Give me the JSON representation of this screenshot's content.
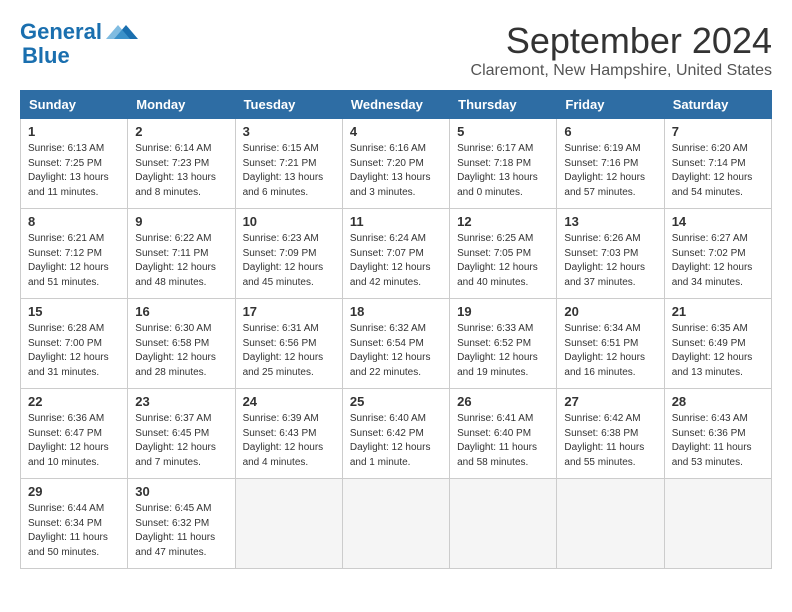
{
  "logo": {
    "line1": "General",
    "line2": "Blue"
  },
  "title": "September 2024",
  "location": "Claremont, New Hampshire, United States",
  "days_of_week": [
    "Sunday",
    "Monday",
    "Tuesday",
    "Wednesday",
    "Thursday",
    "Friday",
    "Saturday"
  ],
  "weeks": [
    [
      {
        "num": "1",
        "sunrise": "6:13 AM",
        "sunset": "7:25 PM",
        "daylight": "13 hours and 11 minutes."
      },
      {
        "num": "2",
        "sunrise": "6:14 AM",
        "sunset": "7:23 PM",
        "daylight": "13 hours and 8 minutes."
      },
      {
        "num": "3",
        "sunrise": "6:15 AM",
        "sunset": "7:21 PM",
        "daylight": "13 hours and 6 minutes."
      },
      {
        "num": "4",
        "sunrise": "6:16 AM",
        "sunset": "7:20 PM",
        "daylight": "13 hours and 3 minutes."
      },
      {
        "num": "5",
        "sunrise": "6:17 AM",
        "sunset": "7:18 PM",
        "daylight": "13 hours and 0 minutes."
      },
      {
        "num": "6",
        "sunrise": "6:19 AM",
        "sunset": "7:16 PM",
        "daylight": "12 hours and 57 minutes."
      },
      {
        "num": "7",
        "sunrise": "6:20 AM",
        "sunset": "7:14 PM",
        "daylight": "12 hours and 54 minutes."
      }
    ],
    [
      {
        "num": "8",
        "sunrise": "6:21 AM",
        "sunset": "7:12 PM",
        "daylight": "12 hours and 51 minutes."
      },
      {
        "num": "9",
        "sunrise": "6:22 AM",
        "sunset": "7:11 PM",
        "daylight": "12 hours and 48 minutes."
      },
      {
        "num": "10",
        "sunrise": "6:23 AM",
        "sunset": "7:09 PM",
        "daylight": "12 hours and 45 minutes."
      },
      {
        "num": "11",
        "sunrise": "6:24 AM",
        "sunset": "7:07 PM",
        "daylight": "12 hours and 42 minutes."
      },
      {
        "num": "12",
        "sunrise": "6:25 AM",
        "sunset": "7:05 PM",
        "daylight": "12 hours and 40 minutes."
      },
      {
        "num": "13",
        "sunrise": "6:26 AM",
        "sunset": "7:03 PM",
        "daylight": "12 hours and 37 minutes."
      },
      {
        "num": "14",
        "sunrise": "6:27 AM",
        "sunset": "7:02 PM",
        "daylight": "12 hours and 34 minutes."
      }
    ],
    [
      {
        "num": "15",
        "sunrise": "6:28 AM",
        "sunset": "7:00 PM",
        "daylight": "12 hours and 31 minutes."
      },
      {
        "num": "16",
        "sunrise": "6:30 AM",
        "sunset": "6:58 PM",
        "daylight": "12 hours and 28 minutes."
      },
      {
        "num": "17",
        "sunrise": "6:31 AM",
        "sunset": "6:56 PM",
        "daylight": "12 hours and 25 minutes."
      },
      {
        "num": "18",
        "sunrise": "6:32 AM",
        "sunset": "6:54 PM",
        "daylight": "12 hours and 22 minutes."
      },
      {
        "num": "19",
        "sunrise": "6:33 AM",
        "sunset": "6:52 PM",
        "daylight": "12 hours and 19 minutes."
      },
      {
        "num": "20",
        "sunrise": "6:34 AM",
        "sunset": "6:51 PM",
        "daylight": "12 hours and 16 minutes."
      },
      {
        "num": "21",
        "sunrise": "6:35 AM",
        "sunset": "6:49 PM",
        "daylight": "12 hours and 13 minutes."
      }
    ],
    [
      {
        "num": "22",
        "sunrise": "6:36 AM",
        "sunset": "6:47 PM",
        "daylight": "12 hours and 10 minutes."
      },
      {
        "num": "23",
        "sunrise": "6:37 AM",
        "sunset": "6:45 PM",
        "daylight": "12 hours and 7 minutes."
      },
      {
        "num": "24",
        "sunrise": "6:39 AM",
        "sunset": "6:43 PM",
        "daylight": "12 hours and 4 minutes."
      },
      {
        "num": "25",
        "sunrise": "6:40 AM",
        "sunset": "6:42 PM",
        "daylight": "12 hours and 1 minute."
      },
      {
        "num": "26",
        "sunrise": "6:41 AM",
        "sunset": "6:40 PM",
        "daylight": "11 hours and 58 minutes."
      },
      {
        "num": "27",
        "sunrise": "6:42 AM",
        "sunset": "6:38 PM",
        "daylight": "11 hours and 55 minutes."
      },
      {
        "num": "28",
        "sunrise": "6:43 AM",
        "sunset": "6:36 PM",
        "daylight": "11 hours and 53 minutes."
      }
    ],
    [
      {
        "num": "29",
        "sunrise": "6:44 AM",
        "sunset": "6:34 PM",
        "daylight": "11 hours and 50 minutes."
      },
      {
        "num": "30",
        "sunrise": "6:45 AM",
        "sunset": "6:32 PM",
        "daylight": "11 hours and 47 minutes."
      },
      null,
      null,
      null,
      null,
      null
    ]
  ]
}
